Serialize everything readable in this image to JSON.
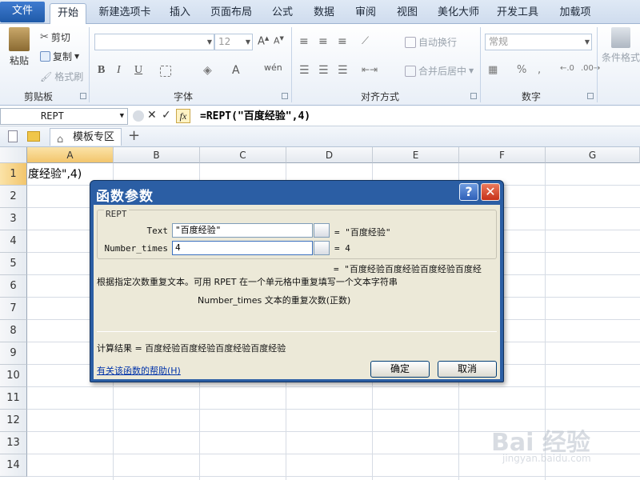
{
  "tabs": {
    "file": "文件",
    "home": "开始",
    "new_tab": "新建选项卡",
    "insert": "插入",
    "page_layout": "页面布局",
    "formulas": "公式",
    "data": "数据",
    "review": "审阅",
    "view": "视图",
    "beautify": "美化大师",
    "developer": "开发工具",
    "addins": "加载项"
  },
  "ribbon": {
    "clipboard": {
      "paste": "粘贴",
      "cut": "剪切",
      "copy": "复制",
      "format_painter": "格式刷",
      "label": "剪贴板"
    },
    "font": {
      "size": "12",
      "label": "字体"
    },
    "alignment": {
      "wrap": "自动换行",
      "merge": "合并后居中",
      "label": "对齐方式"
    },
    "number": {
      "format": "常规",
      "label": "数字"
    },
    "styles": {
      "conditional": "条件格式"
    }
  },
  "formula_bar": {
    "name_box": "REPT",
    "formula": "=REPT(\"百度经验\",4)"
  },
  "doc_tabs": {
    "template": "模板专区",
    "add": "+"
  },
  "grid": {
    "columns": [
      "A",
      "B",
      "C",
      "D",
      "E",
      "F",
      "G"
    ],
    "rows": [
      "1",
      "2",
      "3",
      "4",
      "5",
      "6",
      "7",
      "8",
      "9",
      "10",
      "11",
      "12",
      "13",
      "14"
    ],
    "cell_a1": "度经验\",4)"
  },
  "dialog": {
    "title": "函数参数",
    "help_button": "?",
    "close_button": "✕",
    "function_name": "REPT",
    "args": [
      {
        "label": "Text",
        "value": "\"百度经验\"",
        "result": "= \"百度经验\""
      },
      {
        "label": "Number_times",
        "value": "4",
        "result": "= 4"
      }
    ],
    "overall_result": "= \"百度经验百度经验百度经验百度经",
    "description": "根据指定次数重复文本。可用 RPET 在一个单元格中重复填写一个文本字符串",
    "arg_description": "Number_times  文本的重复次数(正数)",
    "calc_result": "计算结果 =  百度经验百度经验百度经验百度经验",
    "help_link": "有关该函数的帮助(H)",
    "ok": "确定",
    "cancel": "取消"
  },
  "watermark": {
    "main": "Bai 经验",
    "sub": "jingyan.baidu.com"
  },
  "colors": {
    "dialog_frame": "#2b5ea4",
    "dialog_body": "#ece9d8",
    "selected_header": "#f2c56c",
    "file_tab": "#1f5aa8"
  }
}
